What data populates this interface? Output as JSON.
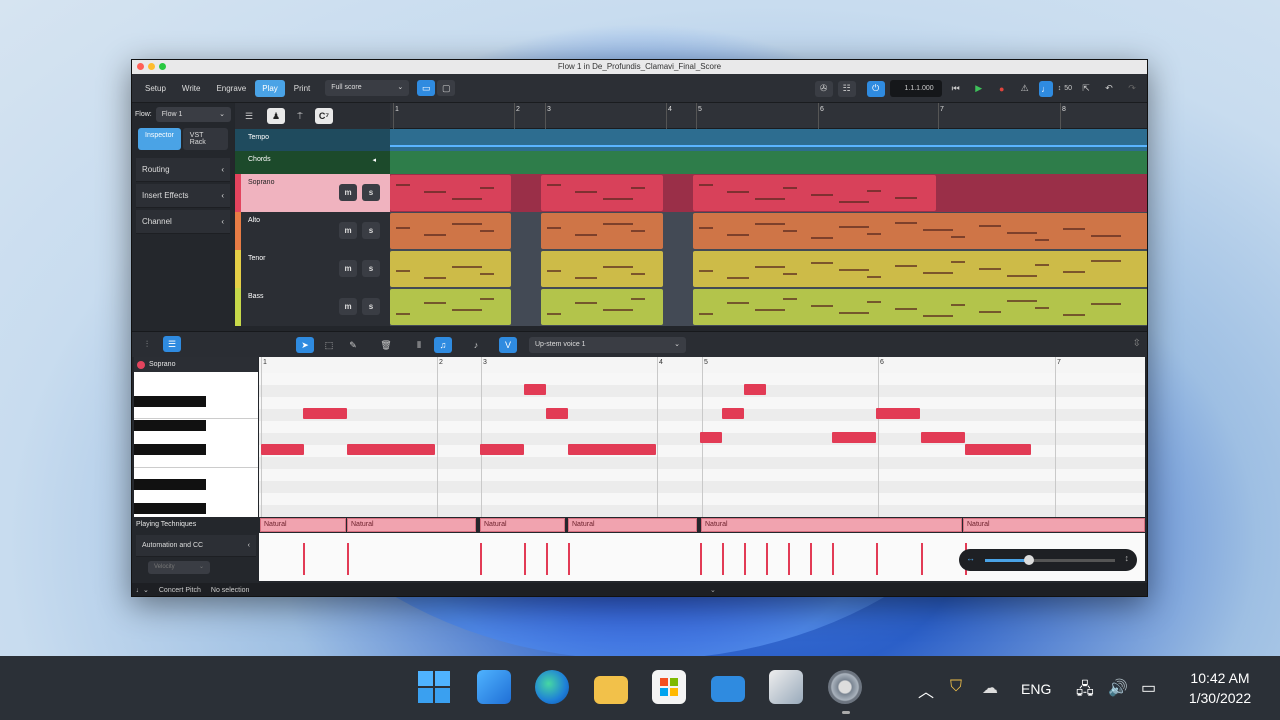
{
  "window": {
    "title": "Flow 1 in De_Profundis_Clamavi_Final_Score"
  },
  "toolbar": {
    "modes": [
      "Setup",
      "Write",
      "Engrave",
      "Play",
      "Print"
    ],
    "active_mode": "Play",
    "layout_select": "Full score",
    "position_counter": "1.1.1.000",
    "tempo_value": "50"
  },
  "left_panel": {
    "flow_label": "Flow:",
    "flow_value": "Flow 1",
    "tab_inspector": "Inspector",
    "tab_vst": "VST Rack",
    "sections": [
      "Routing",
      "Insert Effects",
      "Channel"
    ]
  },
  "tracks": {
    "ruler": [
      "1",
      "2",
      "3",
      "4",
      "5",
      "6",
      "7",
      "8"
    ],
    "tempo_label": "Tempo",
    "chords_label": "Chords",
    "instruments": [
      {
        "name": "Soprano",
        "color": "#e3445e",
        "mute": "m",
        "solo": "s"
      },
      {
        "name": "Alto",
        "color": "#e77c45",
        "mute": "m",
        "solo": "s"
      },
      {
        "name": "Tenor",
        "color": "#e5cf47",
        "mute": "m",
        "solo": "s"
      },
      {
        "name": "Bass",
        "color": "#c7d94a",
        "mute": "m",
        "solo": "s"
      }
    ]
  },
  "editor": {
    "voice_select": "Up-stem voice 1",
    "instrument_label": "Soprano",
    "ruler": [
      "1",
      "2",
      "3",
      "4",
      "5",
      "6",
      "7"
    ],
    "playing_techniques_label": "Playing Techniques",
    "technique_name": "Natural",
    "automation_label": "Automation and CC",
    "velocity_label": "Velocity"
  },
  "status_bar": {
    "concert_pitch": "Concert Pitch",
    "selection": "No selection"
  },
  "taskbar": {
    "language": "ENG",
    "time": "10:42 AM",
    "date": "1/30/2022"
  }
}
